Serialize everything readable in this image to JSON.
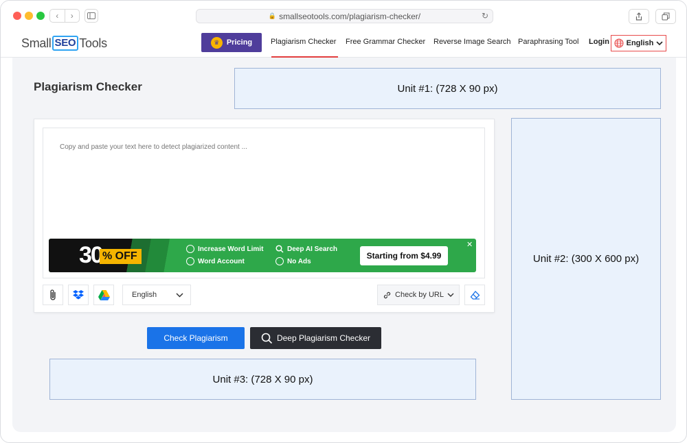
{
  "browser": {
    "url": "smallseotools.com/plagiarism-checker/"
  },
  "header": {
    "logo": {
      "part1": "Small",
      "part2": "SEO",
      "part3": "Tools"
    },
    "pricing_label": "Pricing",
    "nav": [
      {
        "label": "Plagiarism Checker",
        "active": true
      },
      {
        "label": "Free Grammar Checker"
      },
      {
        "label": "Reverse Image Search"
      },
      {
        "label": "Paraphrasing Tool"
      },
      {
        "label": "Login"
      }
    ],
    "language": "English",
    "colors": {
      "pricing_bg": "#4f3d9b",
      "active_underline": "#e23d3d"
    }
  },
  "main": {
    "title": "Plagiarism Checker",
    "ads": {
      "unit1": "Unit #1: (728 X 90 px)",
      "unit2": "Unit #2: (300 X 600 px)",
      "unit3": "Unit #3: (728 X 90 px)"
    },
    "checker": {
      "placeholder": "Copy and paste your text here to detect plagiarized content ...",
      "promo": {
        "discount_number": "30",
        "discount_suffix": "% OFF",
        "features": [
          "Increase Word Limit",
          "Word Account",
          "Deep AI Search",
          "No Ads"
        ],
        "cta": "Starting from $4.99",
        "close": "✕"
      },
      "language_select": "English",
      "check_by_url": "Check by URL"
    },
    "buttons": {
      "check": "Check Plagiarism",
      "deep": "Deep Plagiarism Checker"
    }
  }
}
